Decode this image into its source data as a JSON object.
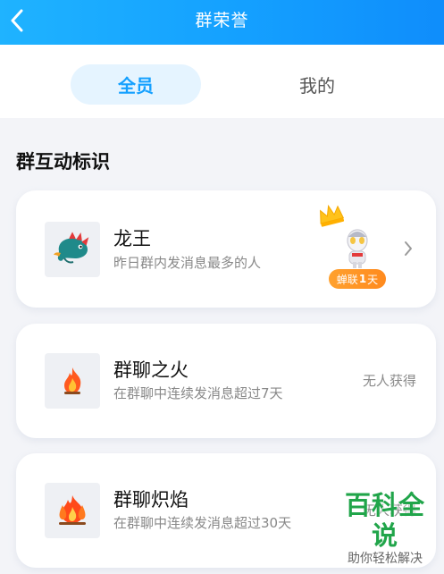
{
  "header": {
    "title": "群荣誉"
  },
  "tabs": [
    {
      "label": "全员",
      "active": true
    },
    {
      "label": "我的",
      "active": false
    }
  ],
  "section": {
    "title": "群互动标识"
  },
  "cards": [
    {
      "name": "龙王",
      "desc": "昨日群内发消息最多的人",
      "holder_badge": {
        "prefix": "蝉联",
        "num": "1",
        "suffix": "天"
      },
      "icon": "dragon-icon"
    },
    {
      "name": "群聊之火",
      "desc": "在群聊中连续发消息超过7天",
      "status": "无人获得",
      "icon": "flame-icon"
    },
    {
      "name": "群聊炽焰",
      "desc": "在群聊中连续发消息超过30天",
      "status": "无人获得",
      "icon": "blaze-icon"
    }
  ],
  "watermark": {
    "main": "百科全说",
    "sub": "助你轻松解决"
  },
  "colors": {
    "header_blue": "#14a0ff",
    "active_tab_bg": "#e5f4ff",
    "badge_orange": "#ff9a26",
    "watermark_green": "#21a54a"
  }
}
